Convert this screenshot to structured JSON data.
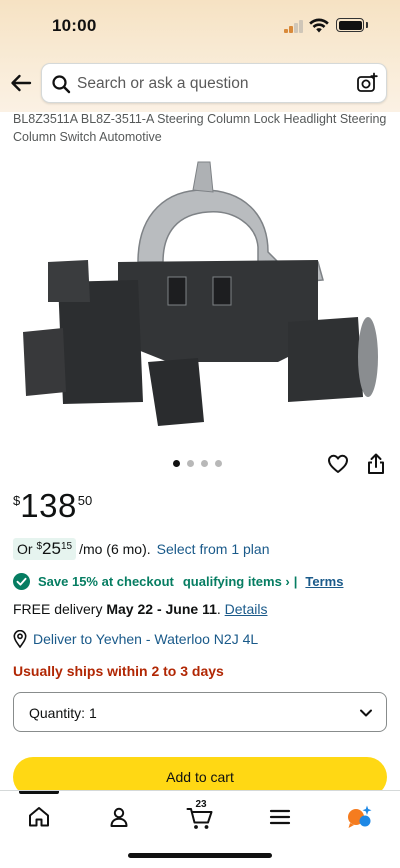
{
  "status_bar": {
    "time": "10:00"
  },
  "search": {
    "placeholder": "Search or ask a question"
  },
  "product": {
    "title": "BL8Z3511A BL8Z-3511-A Steering Column Lock Headlight Steering Column Switch Automotive",
    "image_count": 4,
    "active_image": 1
  },
  "price": {
    "symbol": "$",
    "whole": "138",
    "fraction": "50"
  },
  "installment": {
    "prefix": "Or ",
    "symbol": "$",
    "whole": "25",
    "fraction": "15",
    "suffix": "/mo (6 mo).",
    "link": "Select from 1 plan"
  },
  "promo": {
    "save_text": "Save 15% at checkout",
    "qualifying": "qualifying items ›",
    "separator": "|",
    "terms": "Terms"
  },
  "delivery": {
    "prefix": "FREE delivery ",
    "dates": "May 22 - June 11",
    "period": ". ",
    "details": "Details"
  },
  "location": {
    "text": "Deliver to Yevhen - Waterloo N2J 4L"
  },
  "shipping": {
    "text": "Usually ships within 2 to 3 days"
  },
  "quantity": {
    "label": "Quantity:",
    "value": "1"
  },
  "cart": {
    "button_label": "Add to cart",
    "count": "23"
  },
  "colors": {
    "accent_yellow": "#ffd814",
    "link_blue": "#1a5a8a",
    "promo_green": "#067d62",
    "ships_red": "#b12704"
  },
  "nav": {
    "items": [
      "home-icon",
      "account-icon",
      "cart-icon",
      "menu-icon",
      "rufus-icon"
    ]
  }
}
